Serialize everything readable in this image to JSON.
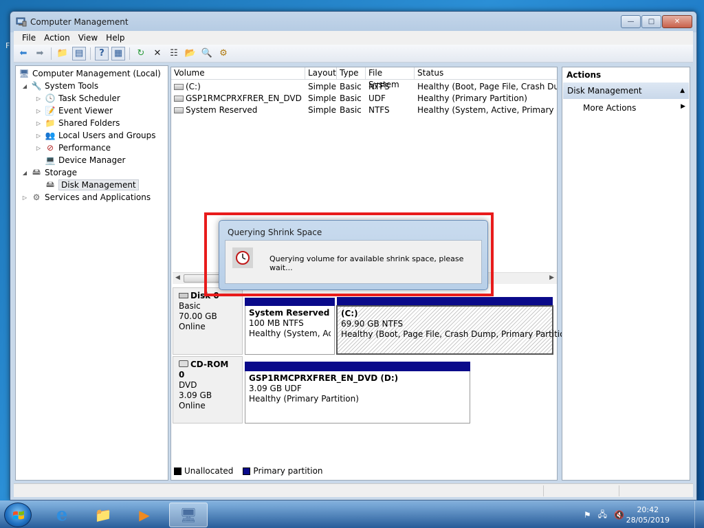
{
  "window": {
    "title": "Computer Management"
  },
  "menu": [
    "File",
    "Action",
    "View",
    "Help"
  ],
  "tree": {
    "root": "Computer Management (Local)",
    "system_tools": "System Tools",
    "task_scheduler": "Task Scheduler",
    "event_viewer": "Event Viewer",
    "shared_folders": "Shared Folders",
    "local_users": "Local Users and Groups",
    "performance": "Performance",
    "device_manager": "Device Manager",
    "storage": "Storage",
    "disk_management": "Disk Management",
    "services_apps": "Services and Applications"
  },
  "volume_list": {
    "columns": [
      "Volume",
      "Layout",
      "Type",
      "File System",
      "Status"
    ],
    "rows": [
      {
        "volume": "(C:)",
        "layout": "Simple",
        "type": "Basic",
        "fs": "NTFS",
        "status": "Healthy (Boot, Page File, Crash Dump,"
      },
      {
        "volume": "GSP1RMCPRXFRER_EN_DVD (D:)",
        "layout": "Simple",
        "type": "Basic",
        "fs": "UDF",
        "status": "Healthy (Primary Partition)"
      },
      {
        "volume": "System Reserved",
        "layout": "Simple",
        "type": "Basic",
        "fs": "NTFS",
        "status": "Healthy (System, Active, Primary Partit"
      }
    ]
  },
  "disks": {
    "disk0": {
      "name": "Disk 0",
      "type": "Basic",
      "size": "70.00 GB",
      "state": "Online"
    },
    "cdrom0": {
      "name": "CD-ROM 0",
      "type": "DVD",
      "size": "3.09 GB",
      "state": "Online"
    },
    "p_system_reserved": {
      "name": "System Reserved",
      "size": "100 MB NTFS",
      "status": "Healthy (System, Activ"
    },
    "p_c": {
      "name": "(C:)",
      "size": "69.90 GB NTFS",
      "status": "Healthy (Boot, Page File, Crash Dump, Primary Partition)"
    },
    "p_dvd": {
      "name": "GSP1RMCPRXFRER_EN_DVD  (D:)",
      "size": "3.09 GB UDF",
      "status": "Healthy (Primary Partition)"
    }
  },
  "legend": {
    "unallocated": "Unallocated",
    "primary": "Primary partition",
    "unallocated_color": "#000000",
    "primary_color": "#0a0a8a"
  },
  "actions": {
    "title": "Actions",
    "section": "Disk Management",
    "more": "More Actions"
  },
  "dialog": {
    "title": "Querying Shrink Space",
    "message": "Querying volume for available shrink space, please wait..."
  },
  "taskbar": {
    "time": "20:42",
    "date": "28/05/2019"
  },
  "colors": {
    "highlight": "#e81b1b",
    "selection": "#e7eaee"
  }
}
